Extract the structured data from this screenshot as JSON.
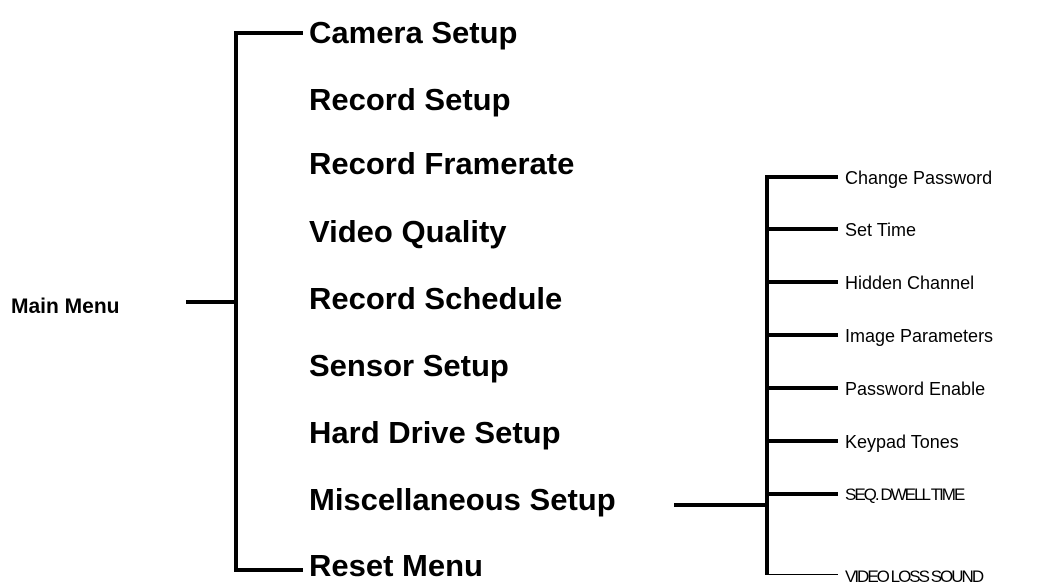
{
  "root": {
    "label": "Main Menu"
  },
  "main_items": [
    {
      "label": "Camera   Setup"
    },
    {
      "label": "Record Setup"
    },
    {
      "label": "Record Framerate"
    },
    {
      "label": "Video Quality"
    },
    {
      "label": "Record Schedule"
    },
    {
      "label": "Sensor Setup"
    },
    {
      "label": "Hard Drive Setup"
    },
    {
      "label": "Miscellaneous Setup"
    },
    {
      "label": "Reset Menu"
    }
  ],
  "sub_items": [
    {
      "label": "Change Password"
    },
    {
      "label": "Set Time"
    },
    {
      "label": "Hidden Channel"
    },
    {
      "label": "Image Parameters"
    },
    {
      "label": "Password Enable"
    },
    {
      "label": "Keypad Tones"
    },
    {
      "label": "SEQ. DWELL TIME"
    },
    {
      "label": "VIDEO LOSS SOUND"
    }
  ]
}
